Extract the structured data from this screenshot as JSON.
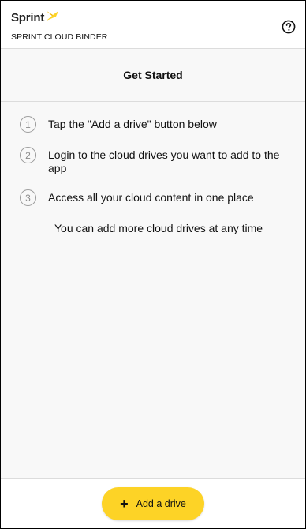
{
  "header": {
    "brand": "Sprint",
    "app_name": "SPRINT CLOUD BINDER",
    "help_icon": "help-circle-icon",
    "brand_color": "#fdd326"
  },
  "section": {
    "title": "Get Started"
  },
  "steps": [
    {
      "number": "1",
      "text": "Tap the \"Add a drive\" button below"
    },
    {
      "number": "2",
      "text": "Login to the cloud drives you want to add to the app"
    },
    {
      "number": "3",
      "text": "Access all your cloud content in one place"
    }
  ],
  "note": "You can add more cloud drives at any time",
  "footer": {
    "add_button_icon": "plus-icon",
    "add_button_label": "Add a drive",
    "accent_color": "#fdd326"
  }
}
